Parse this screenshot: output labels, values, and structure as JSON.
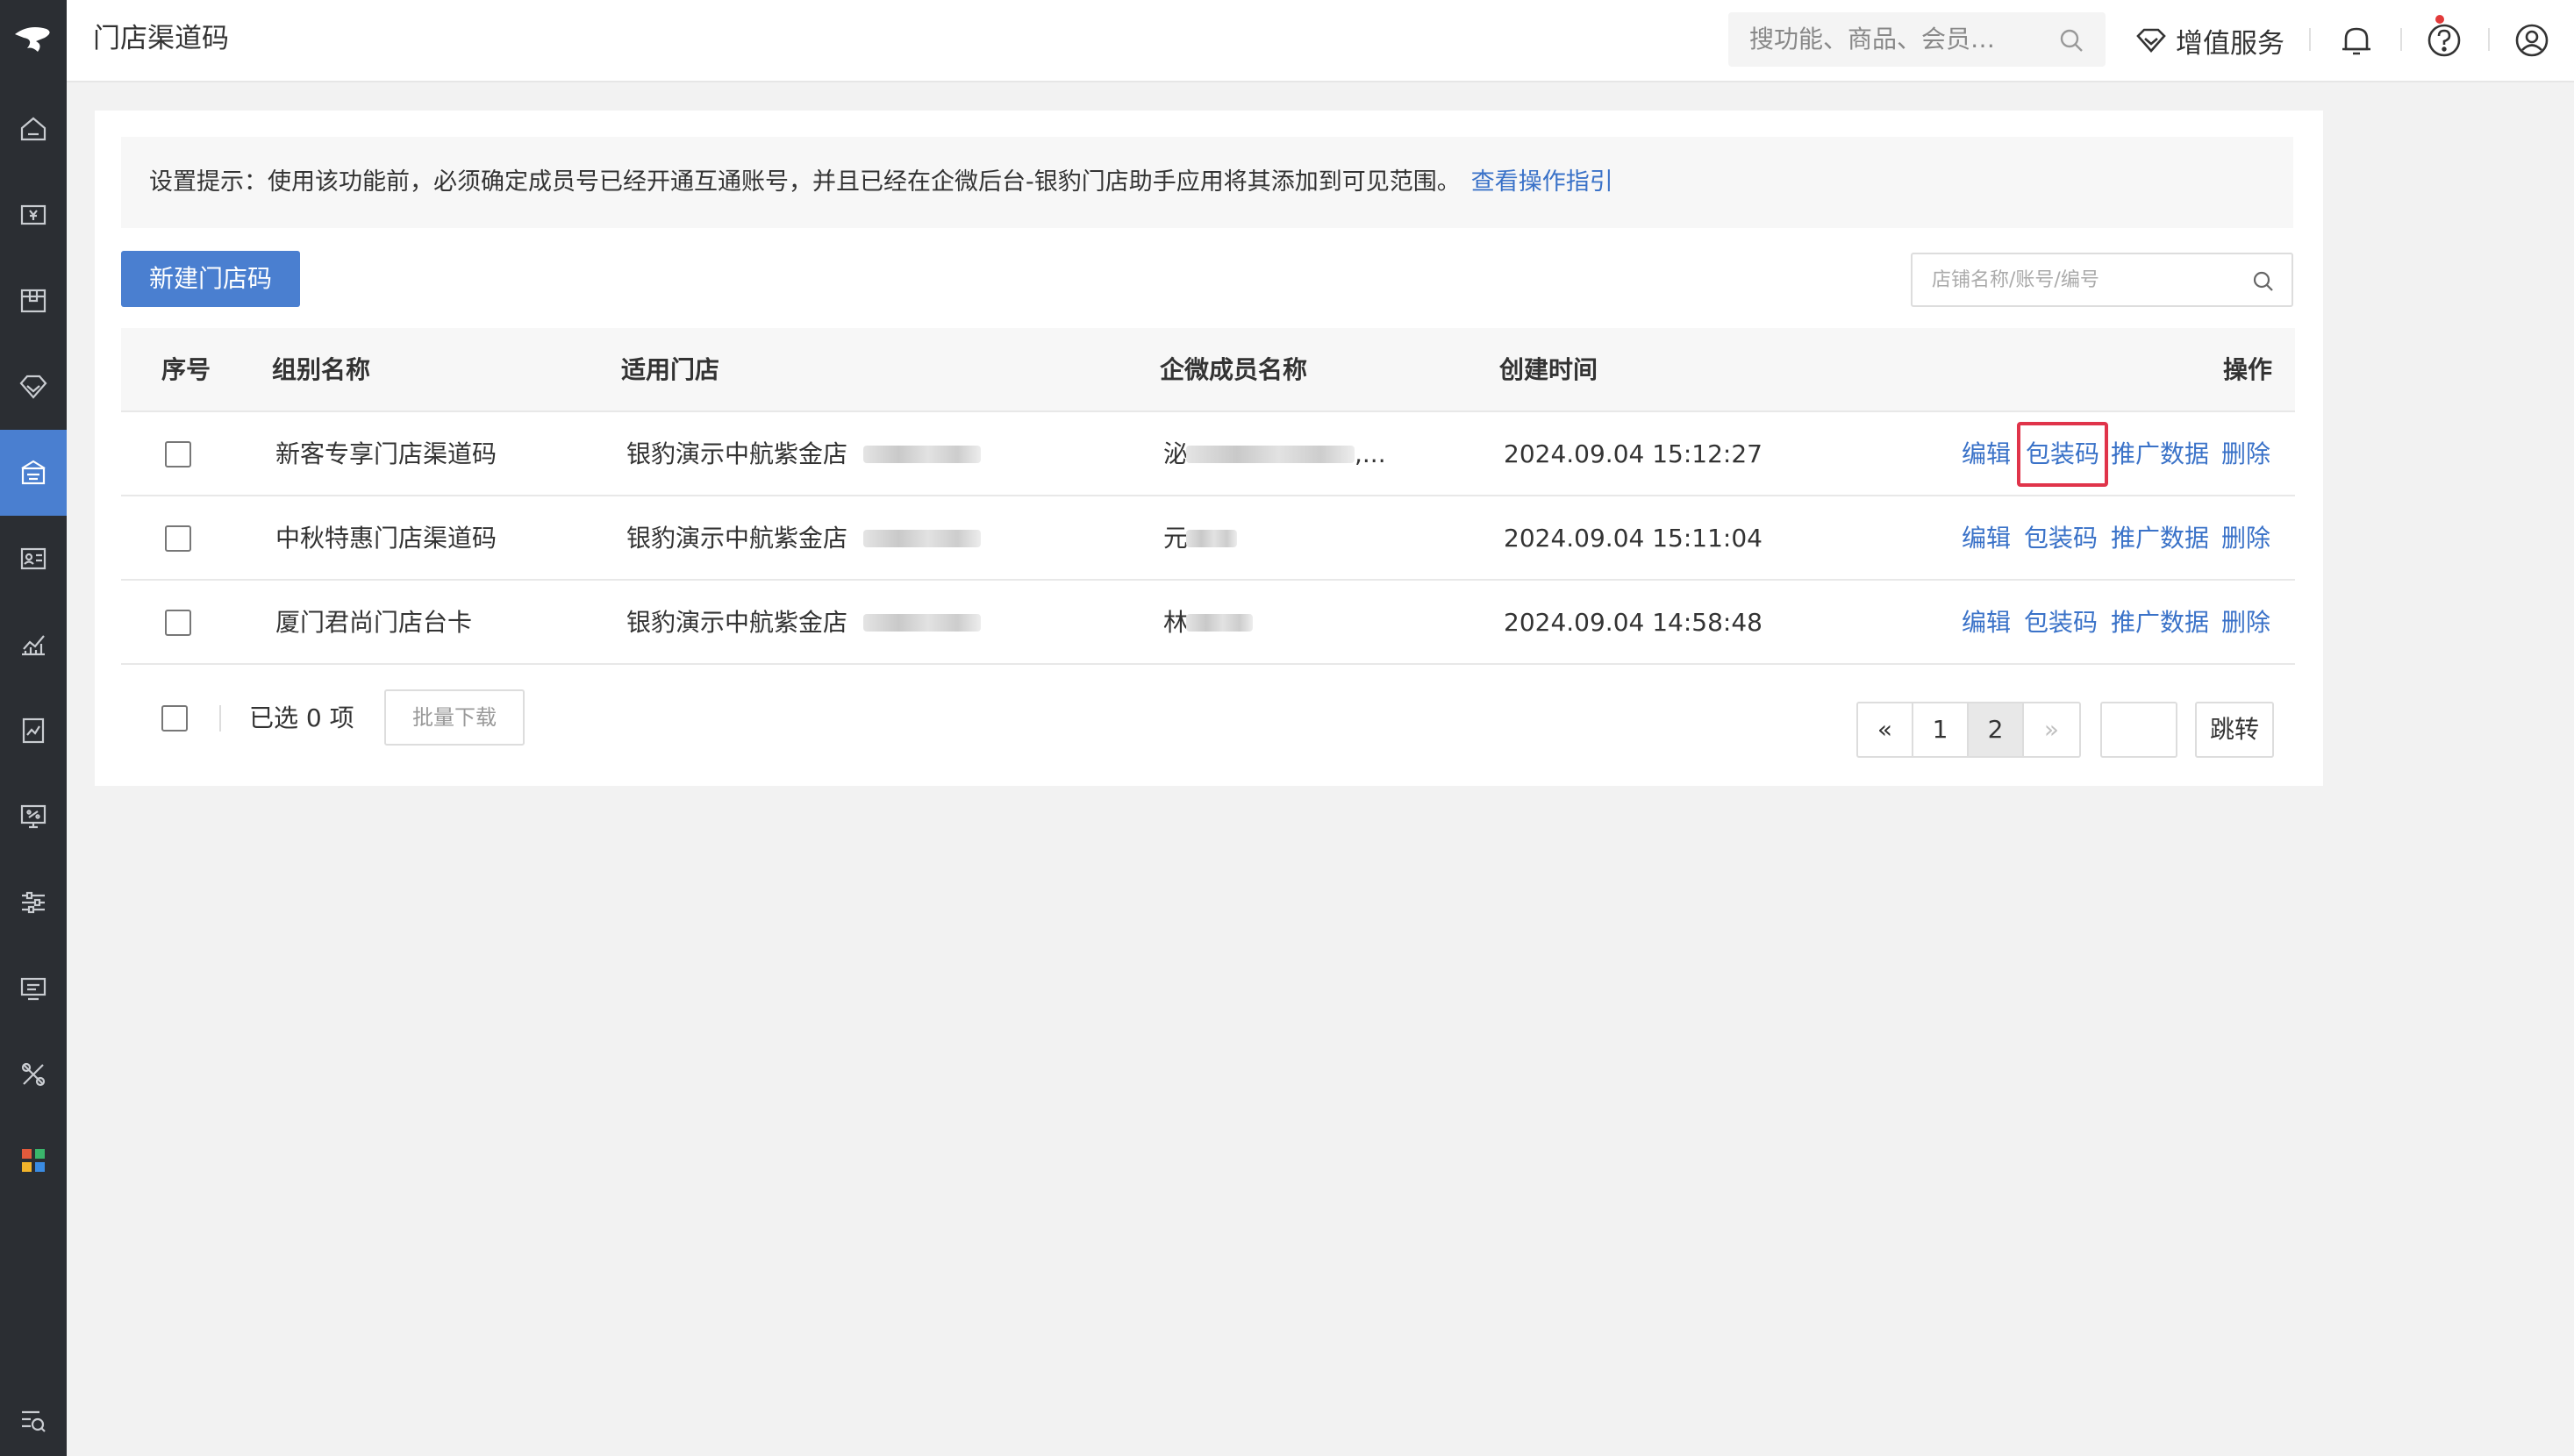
{
  "header": {
    "page_title": "门店渠道码",
    "search_placeholder": "搜功能、商品、会员…",
    "vip_label": "增值服务"
  },
  "sidebar": {
    "items": [
      "home-icon",
      "finance-icon",
      "box-icon",
      "diamond-icon",
      "store-icon",
      "member-card-icon",
      "analytics-icon",
      "report-icon",
      "promotion-icon",
      "settings-icon",
      "device-icon",
      "tools-icon",
      "apps-icon",
      "search-list-icon"
    ],
    "active_index": 4
  },
  "notice": {
    "text": "设置提示：使用该功能前，必须确定成员号已经开通互通账号，并且已经在企微后台-银豹门店助手应用将其添加到可见范围。",
    "link": "查看操作指引"
  },
  "toolbar": {
    "new_button": "新建门店码",
    "search_placeholder": "店铺名称/账号/编号"
  },
  "table": {
    "columns": [
      "序号",
      "组别名称",
      "适用门店",
      "企微成员名称",
      "创建时间",
      "操作"
    ],
    "rows": [
      {
        "name": "新客专享门店渠道码",
        "store": "银豹演示中航紫金店",
        "member": "泌",
        "member_suffix": ",...",
        "created": "2024.09.04 15:12:27"
      },
      {
        "name": "中秋特惠门店渠道码",
        "store": "银豹演示中航紫金店",
        "member": "元",
        "member_suffix": "",
        "created": "2024.09.04 15:11:04"
      },
      {
        "name": "厦门君尚门店台卡",
        "store": "银豹演示中航紫金店",
        "member": "林",
        "member_suffix": "",
        "created": "2024.09.04 14:58:48"
      }
    ],
    "actions": [
      "编辑",
      "包装码",
      "推广数据",
      "删除"
    ]
  },
  "footer": {
    "selected_text": "已选 0 项",
    "batch_download": "批量下载"
  },
  "pagination": {
    "prev": "«",
    "pages": [
      "1",
      "2"
    ],
    "current": "2",
    "next": "»",
    "jump_label": "跳转"
  },
  "colors": {
    "accent": "#4a7fd0",
    "link": "#3a72c8",
    "highlight": "#e0344a",
    "sidebar": "#2b2e33"
  }
}
